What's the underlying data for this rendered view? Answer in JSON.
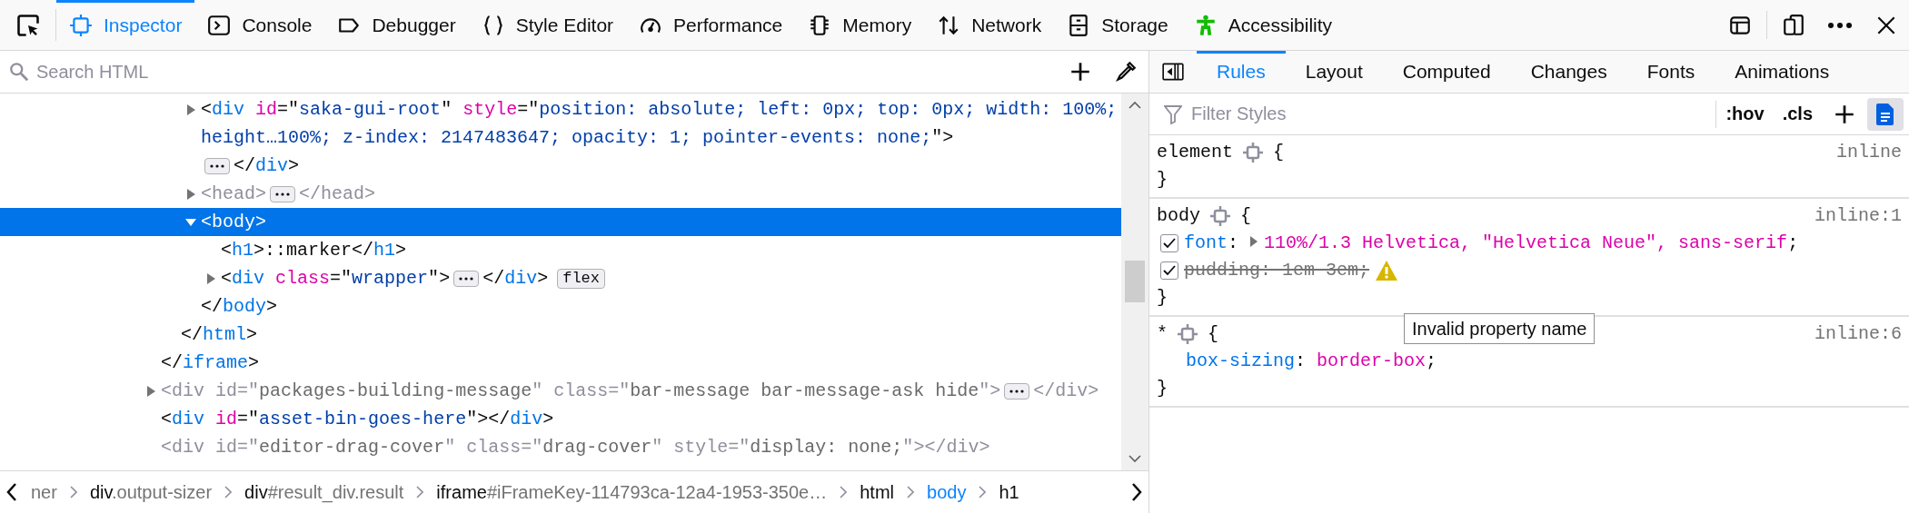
{
  "toolbar": {
    "tabs": [
      {
        "label": "Inspector",
        "selected": true
      },
      {
        "label": "Console",
        "selected": false
      },
      {
        "label": "Debugger",
        "selected": false
      },
      {
        "label": "Style Editor",
        "selected": false
      },
      {
        "label": "Performance",
        "selected": false
      },
      {
        "label": "Memory",
        "selected": false
      },
      {
        "label": "Network",
        "selected": false
      },
      {
        "label": "Storage",
        "selected": false
      },
      {
        "label": "Accessibility",
        "selected": false
      }
    ]
  },
  "markup": {
    "search": {
      "placeholder": "Search HTML"
    },
    "tree": [
      {
        "children": [
          {
            "children": [
              {
                "selected": false,
                "dimmed": false,
                "expanded": false,
                "text": "<div id=\"saka-gui-root\" style=\"position: absolute; left: 0px; top: 0px; width: 100%; height…100%; z-index: 2147483647; opacity: 1; pointer-events: none;\">",
                "closing": "</div>"
              },
              {
                "selected": false,
                "dimmed": true,
                "expanded": false,
                "text": "<head>",
                "closing": "</head>"
              },
              {
                "selected": true,
                "dimmed": false,
                "expanded": true,
                "text": "<body>",
                "children": [
                  {
                    "selected": false,
                    "dimmed": false,
                    "text": "<h1>::marker</h1>"
                  },
                  {
                    "selected": false,
                    "dimmed": false,
                    "expanded": false,
                    "text": "<div class=\"wrapper\">",
                    "closing": "</div>",
                    "badge": "flex"
                  }
                ]
              },
              {
                "selected": false,
                "dimmed": false,
                "text": "</body>"
              }
            ]
          },
          {
            "selected": false,
            "dimmed": false,
            "text": "</html>"
          }
        ]
      },
      {
        "selected": false,
        "dimmed": false,
        "text": "</iframe>"
      },
      {
        "selected": false,
        "dimmed": true,
        "expanded": false,
        "text": "<div id=\"packages-building-message\" class=\"bar-message bar-message-ask hide\">",
        "closing": "</div>"
      },
      {
        "selected": false,
        "dimmed": false,
        "text": "<div id=\"asset-bin-goes-here\"></div>"
      },
      {
        "selected": false,
        "dimmed": true,
        "text": "<div id=\"editor-drag-cover\" class=\"drag-cover\" style=\"display: none;\"></div>"
      }
    ]
  },
  "breadcrumbs": [
    {
      "detail": "ner",
      "selected": false
    },
    {
      "tag": "div",
      "detail": ".output-sizer",
      "selected": false
    },
    {
      "tag": "div",
      "detail": "#result_div.result",
      "selected": false
    },
    {
      "tag": "iframe",
      "detail": "#iFrameKey-114793ca-12a4-1953-350e…",
      "selected": false
    },
    {
      "tag": "html",
      "selected": false
    },
    {
      "tag": "body",
      "selected": true
    },
    {
      "tag": "h1",
      "selected": false
    }
  ],
  "sidebar": {
    "tabs": [
      {
        "label": "Rules",
        "selected": true
      },
      {
        "label": "Layout",
        "selected": false
      },
      {
        "label": "Computed",
        "selected": false
      },
      {
        "label": "Changes",
        "selected": false
      },
      {
        "label": "Fonts",
        "selected": false
      },
      {
        "label": "Animations",
        "selected": false
      }
    ],
    "filter": {
      "placeholder": "Filter Styles"
    },
    "buttons": [
      ":hov",
      ".cls"
    ],
    "rules": [
      {
        "selector": "element",
        "open": "{",
        "close": "}",
        "source": "inline"
      },
      {
        "selector": "body",
        "open": "{",
        "close": "}",
        "source": "inline:1",
        "declarations": [
          {
            "checked": true,
            "invalid": false,
            "expandable": true,
            "name": "font",
            "colon": ":",
            "value": "110%/1.3 Helvetica, \"Helvetica Neue\", sans-serif",
            "end": ";"
          },
          {
            "checked": true,
            "invalid": true,
            "expandable": false,
            "name": "pudding",
            "colon": ":",
            "value": "1em 3em",
            "end": ";"
          }
        ]
      },
      {
        "selector": "*",
        "open": "{",
        "close": "}",
        "source": "inline:6",
        "declarations": [
          {
            "invalid": false,
            "expandable": false,
            "name": "box-sizing",
            "colon": ":",
            "value": "border-box",
            "end": ";"
          }
        ]
      }
    ],
    "tooltip": "Invalid property name"
  }
}
